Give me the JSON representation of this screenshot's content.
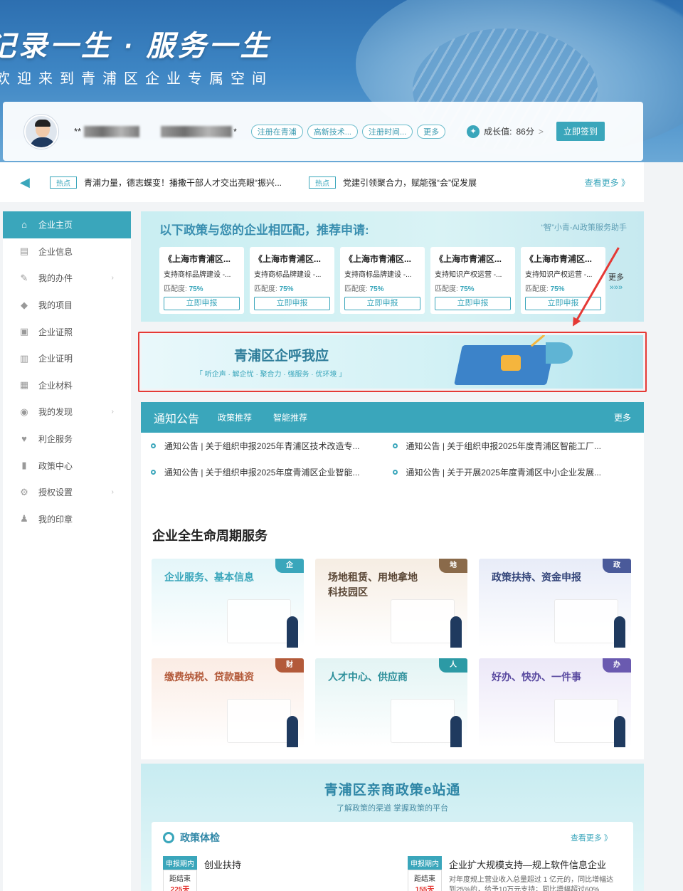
{
  "banner": {
    "slogan": "记录一生 · 服务一生",
    "subtitle": "欢迎来到青浦区企业专属空间"
  },
  "user": {
    "name_prefix": "**",
    "company_suffix": "*",
    "tags": [
      "注册在青浦",
      "高新技术...",
      "注册时间...",
      "更多"
    ],
    "growth_label": "成长值:",
    "growth_value": "86分",
    "growth_arrow": ">",
    "sign_button": "立即签到"
  },
  "hot": {
    "badge": "热点",
    "items": [
      "青浦力量，德志蝶变！播撒干部人才交出亮眼“振兴...",
      "党建引领聚合力，赋能强“会”促发展"
    ],
    "more": "查看更多 》"
  },
  "sidebar": {
    "items": [
      {
        "label": "企业主页",
        "icon": "home-icon",
        "glyph": "⌂"
      },
      {
        "label": "企业信息",
        "icon": "id-card-icon",
        "glyph": "▤"
      },
      {
        "label": "我的办件",
        "icon": "edit-icon",
        "glyph": "✎",
        "arrow": "›"
      },
      {
        "label": "我的项目",
        "icon": "layers-icon",
        "glyph": "◆"
      },
      {
        "label": "企业证照",
        "icon": "license-icon",
        "glyph": "▣"
      },
      {
        "label": "企业证明",
        "icon": "certificate-icon",
        "glyph": "▥"
      },
      {
        "label": "企业材料",
        "icon": "folder-icon",
        "glyph": "▦"
      },
      {
        "label": "我的发现",
        "icon": "broadcast-icon",
        "glyph": "◉",
        "arrow": "›"
      },
      {
        "label": "利企服务",
        "icon": "heart-icon",
        "glyph": "♥"
      },
      {
        "label": "政策中心",
        "icon": "book-icon",
        "glyph": "▮"
      },
      {
        "label": "授权设置",
        "icon": "gear-icon",
        "glyph": "⚙",
        "arrow": "›"
      },
      {
        "label": "我的印章",
        "icon": "stamp-icon",
        "glyph": "♟"
      }
    ]
  },
  "recommend": {
    "title": "以下政策与您的企业相匹配，推荐申请:",
    "assistant": "“智”小青-AI政策服务助手",
    "match_label": "匹配度:",
    "apply_label": "立即申报",
    "more": "更多",
    "more_arrows": "»»»",
    "cards": [
      {
        "title": "《上海市青浦区...",
        "desc": "支持商标品牌建设 -...",
        "match": "75%"
      },
      {
        "title": "《上海市青浦区...",
        "desc": "支持商标品牌建设 -...",
        "match": "75%"
      },
      {
        "title": "《上海市青浦区...",
        "desc": "支持商标品牌建设 -...",
        "match": "75%"
      },
      {
        "title": "《上海市青浦区...",
        "desc": "支持知识产权运营 -...",
        "match": "75%"
      },
      {
        "title": "《上海市青浦区...",
        "desc": "支持知识产权运营 -...",
        "match": "75%"
      }
    ]
  },
  "call": {
    "title": "青浦区企呼我应",
    "slogan": "「 听企声 · 解企忧 · 聚合力 · 强服务 · 优环境 」"
  },
  "notice": {
    "tab_active": "通知公告",
    "tabs": [
      "政策推荐",
      "智能推荐"
    ],
    "more": "更多",
    "items": [
      "通知公告 | 关于组织申报2025年青浦区技术改造专...",
      "通知公告 | 关于组织申报2025年度青浦区智能工厂...",
      "通知公告 | 关于组织申报2025年度青浦区企业智能...",
      "通知公告 | 关于开展2025年度青浦区中小企业发展..."
    ]
  },
  "lifecycle": {
    "title": "企业全生命周期服务",
    "cards": [
      {
        "label": "企业服务、基本信息",
        "corner": "企"
      },
      {
        "label": "场地租赁、用地拿地\n科技园区",
        "corner": "地"
      },
      {
        "label": "政策扶持、资金申报",
        "corner": "政"
      },
      {
        "label": "缴费纳税、贷款融资",
        "corner": "财"
      },
      {
        "label": "人才中心、供应商",
        "corner": "人"
      },
      {
        "label": "好办、快办、一件事",
        "corner": "办"
      }
    ]
  },
  "estation": {
    "title": "青浦区亲商政策e站通",
    "subtitle": "了解政策的渠道 掌握政策的平台",
    "section": "政策体检",
    "more": "查看更多 》",
    "rows": [
      {
        "badge": "申报期内",
        "remain": "距结束",
        "days": "225天",
        "title": "创业扶持",
        "desc": ""
      },
      {
        "badge": "申报期内",
        "remain": "距结束",
        "days": "155天",
        "title": "企业扩大规模支持—规上软件信息企业",
        "desc": "对年度规上营业收入总量超过 1 亿元的，同比增幅达到25%的，给予10万元支持；同比增幅超过60%"
      }
    ]
  }
}
